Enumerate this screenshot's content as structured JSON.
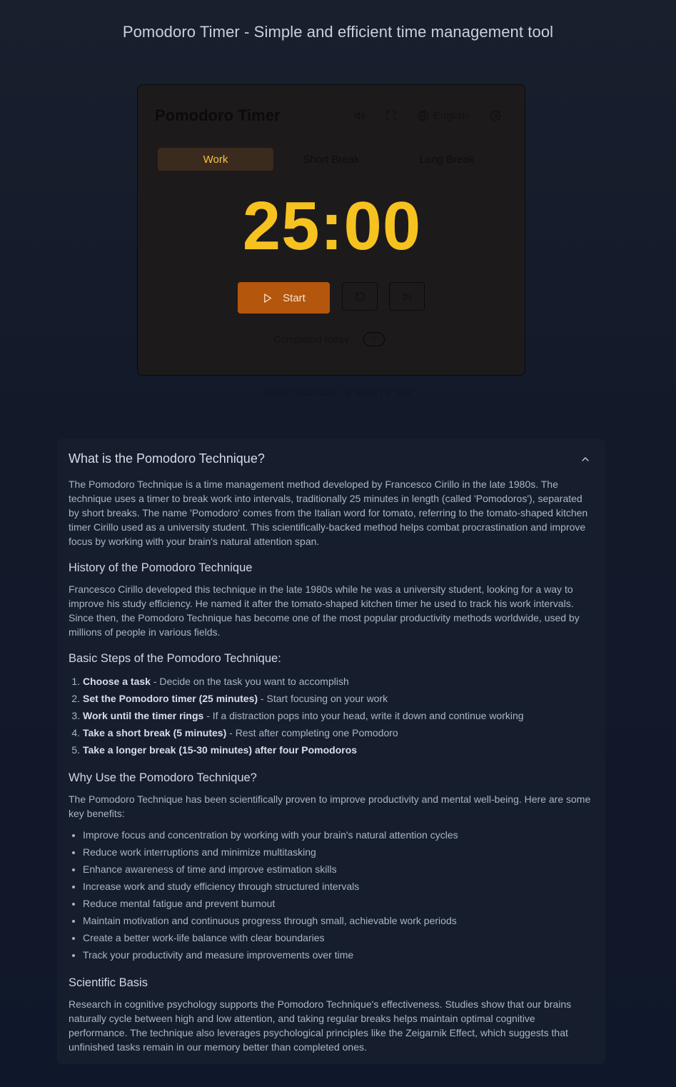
{
  "page": {
    "heading": "Pomodoro Timer - Simple and efficient time management tool",
    "shortcuts_hint": "Space: Start/Pause | R: Reset | S: Skip"
  },
  "timer": {
    "title": "Pomodoro Timer",
    "language": "English",
    "tabs": [
      "Work",
      "Short Break",
      "Long Break"
    ],
    "active_tab": "Work",
    "time": "25:00",
    "start_label": "Start",
    "completed_label": "Completed today:",
    "completed_count": "0",
    "colors": {
      "accent": "#f6c220",
      "start_button": "#b4570c",
      "active_tab_bg": "#3b2a1e"
    },
    "icons": [
      "volume-icon",
      "fullscreen-icon",
      "globe-icon",
      "gear-icon",
      "play-icon",
      "reset-icon",
      "skip-icon"
    ]
  },
  "info": {
    "title": "What is the Pomodoro Technique?",
    "intro": "The Pomodoro Technique is a time management method developed by Francesco Cirillo in the late 1980s. The technique uses a timer to break work into intervals, traditionally 25 minutes in length (called 'Pomodoros'), separated by short breaks. The name 'Pomodoro' comes from the Italian word for tomato, referring to the tomato-shaped kitchen timer Cirillo used as a university student. This scientifically-backed method helps combat procrastination and improve focus by working with your brain's natural attention span.",
    "history_title": "History of the Pomodoro Technique",
    "history_text": "Francesco Cirillo developed this technique in the late 1980s while he was a university student, looking for a way to improve his study efficiency. He named it after the tomato-shaped kitchen timer he used to track his work intervals. Since then, the Pomodoro Technique has become one of the most popular productivity methods worldwide, used by millions of people in various fields.",
    "steps_title": "Basic Steps of the Pomodoro Technique:",
    "steps": [
      {
        "bold": "Choose a task",
        "text": " - Decide on the task you want to accomplish"
      },
      {
        "bold": "Set the Pomodoro timer (25 minutes)",
        "text": " - Start focusing on your work"
      },
      {
        "bold": "Work until the timer rings",
        "text": " - If a distraction pops into your head, write it down and continue working"
      },
      {
        "bold": "Take a short break (5 minutes)",
        "text": " - Rest after completing one Pomodoro"
      },
      {
        "bold": "Take a longer break (15-30 minutes) after four Pomodoros",
        "text": ""
      }
    ],
    "why_title": "Why Use the Pomodoro Technique?",
    "why_intro": "The Pomodoro Technique has been scientifically proven to improve productivity and mental well-being. Here are some key benefits:",
    "benefits": [
      "Improve focus and concentration by working with your brain's natural attention cycles",
      "Reduce work interruptions and minimize multitasking",
      "Enhance awareness of time and improve estimation skills",
      "Increase work and study efficiency through structured intervals",
      "Reduce mental fatigue and prevent burnout",
      "Maintain motivation and continuous progress through small, achievable work periods",
      "Create a better work-life balance with clear boundaries",
      "Track your productivity and measure improvements over time"
    ],
    "science_title": "Scientific Basis",
    "science_text": "Research in cognitive psychology supports the Pomodoro Technique's effectiveness. Studies show that our brains naturally cycle between high and low attention, and taking regular breaks helps maintain optimal cognitive performance. The technique also leverages psychological principles like the Zeigarnik Effect, which suggests that unfinished tasks remain in our memory better than completed ones."
  }
}
